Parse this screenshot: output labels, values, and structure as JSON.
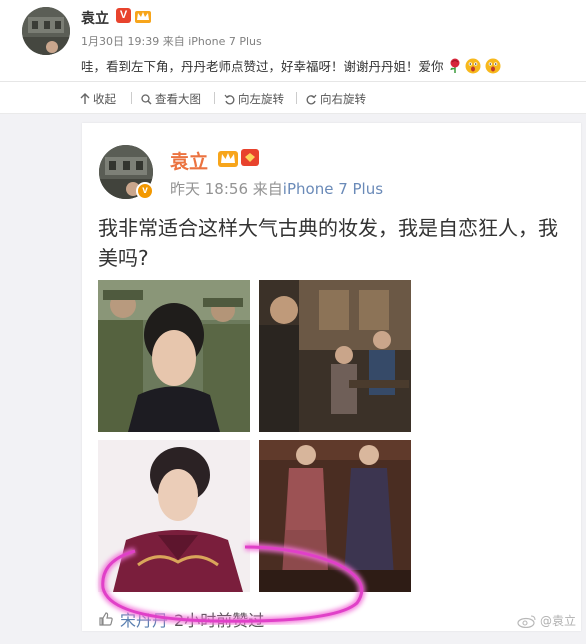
{
  "post": {
    "author": "袁立",
    "verified_badge": "V",
    "meta_date": "1月30日 19:39",
    "meta_source_prefix": "来自",
    "meta_source": "iPhone 7 Plus",
    "text": "哇，看到左下角，丹丹老师点赞过，好幸福呀！谢谢丹丹姐！爱你"
  },
  "toolbar": {
    "collapse_label": "收起",
    "view_large_label": "查看大图",
    "rotate_left_label": "向左旋转",
    "rotate_right_label": "向右旋转"
  },
  "embedded": {
    "author": "袁立",
    "avatar_badge": "v",
    "time": "昨天 18:56",
    "source_prefix": "来自",
    "source": "iPhone 7 Plus",
    "text": "我非常适合这样大气古典的妆发，我是自恋狂人，我美吗?",
    "like_user": "宋丹丹",
    "like_time": "2小时前赞过"
  },
  "watermark": "@袁立",
  "colors": {
    "name_orange": "#eb7340",
    "link_blue": "#5a7fb0",
    "verified_red": "#e8432d",
    "highlight_magenta": "#e040c8"
  },
  "icons": [
    "collapse-icon",
    "zoom-icon",
    "rotate-left-icon",
    "rotate-right-icon",
    "thumbs-up-icon",
    "weibo-icon",
    "crown-icon",
    "rose-icon",
    "surprised-face-icon"
  ]
}
